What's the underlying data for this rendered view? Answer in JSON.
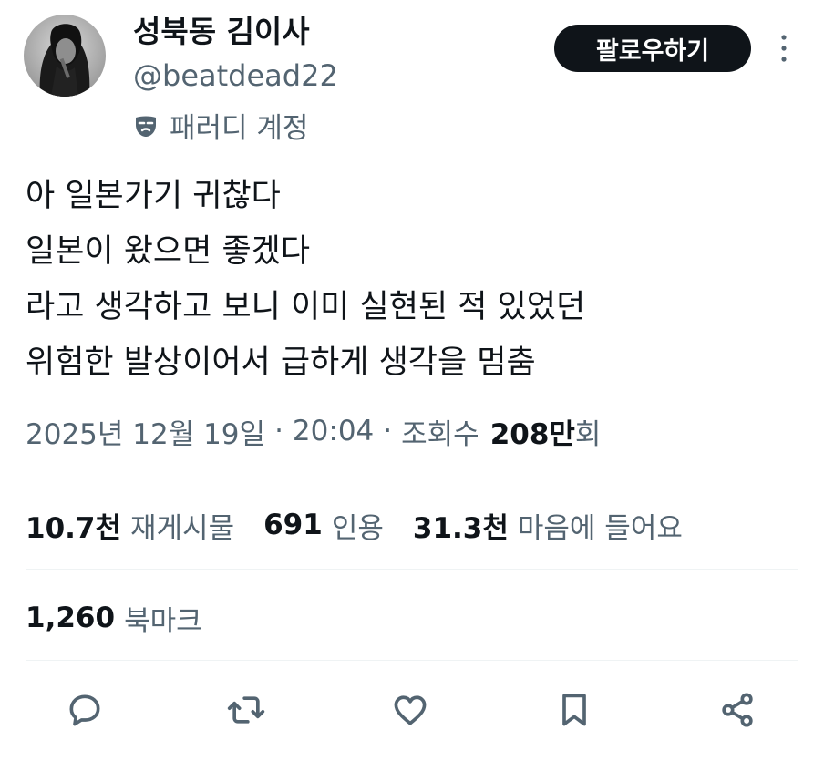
{
  "author": {
    "display_name": "성북동 김이사",
    "handle": "@beatdead22",
    "label": "패러디 계정"
  },
  "follow_button_label": "팔로우하기",
  "tweet": {
    "lines": [
      "아 일본가기 귀찮다",
      "일본이 왔으면 좋겠다",
      "라고 생각하고 보니 이미 실현된 적 있었던",
      "위험한 발상이어서 급하게 생각을 멈춤"
    ]
  },
  "meta": {
    "date": "2025년 12월 19일",
    "separator": "·",
    "time": "20:04",
    "views_label": "조회수",
    "views_number": "208만",
    "views_suffix": "회"
  },
  "stats": {
    "retweets": {
      "number": "10.7천",
      "label": "재게시물"
    },
    "quotes": {
      "number": "691",
      "label": "인용"
    },
    "likes": {
      "number": "31.3천",
      "label": "마음에 들어요"
    },
    "bookmarks": {
      "number": "1,260",
      "label": "북마크"
    }
  },
  "icons": {
    "parody": "mask-icon",
    "more": "more-vertical-icon",
    "reply": "reply-icon",
    "retweet": "retweet-icon",
    "like": "heart-icon",
    "bookmark": "bookmark-icon",
    "share": "share-icon"
  },
  "colors": {
    "text_primary": "#0f1419",
    "text_secondary": "#536471",
    "divider": "#eff3f4",
    "button_bg": "#0f1419",
    "button_text": "#ffffff"
  }
}
